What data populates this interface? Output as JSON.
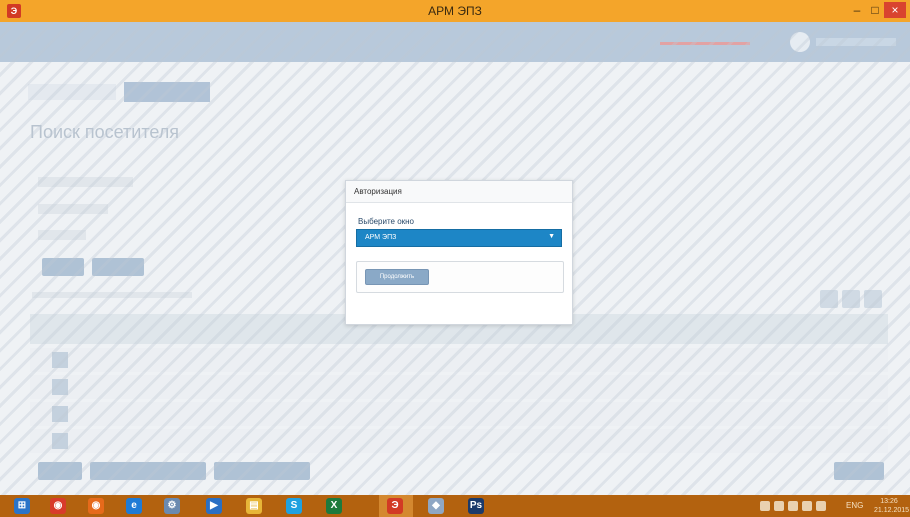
{
  "window": {
    "title": "АРМ ЭПЗ",
    "minimize_label": "–",
    "maximize_label": "□",
    "close_label": "×",
    "app_icon": "app-icon"
  },
  "background": {
    "page_title": "Поиск посетителя"
  },
  "modal": {
    "title": "Авторизация",
    "select_label": "Выберите окно",
    "select_value": "АРМ ЭПЗ",
    "continue_label": "Продолжить"
  },
  "taskbar": {
    "items": [
      {
        "name": "windows-start-icon",
        "glyph": "⊞",
        "color": "#2a74c8"
      },
      {
        "name": "chrome-icon",
        "glyph": "◉",
        "color": "#d83b2b"
      },
      {
        "name": "firefox-icon",
        "glyph": "◉",
        "color": "#e66a1b"
      },
      {
        "name": "ie-icon",
        "glyph": "e",
        "color": "#1e7bd6"
      },
      {
        "name": "network-icon",
        "glyph": "⚙",
        "color": "#6b8ab0"
      },
      {
        "name": "teamviewer-icon",
        "glyph": "▶",
        "color": "#2a6fc4"
      },
      {
        "name": "folder-icon",
        "glyph": "▤",
        "color": "#e7b638"
      },
      {
        "name": "skype-icon",
        "glyph": "S",
        "color": "#1fa1e0"
      },
      {
        "name": "excel-icon",
        "glyph": "X",
        "color": "#1d7a3c"
      },
      {
        "name": "app-icon",
        "glyph": "Э",
        "color": "#d23a24"
      },
      {
        "name": "sql-icon",
        "glyph": "◆",
        "color": "#8fa7c4"
      },
      {
        "name": "photoshop-icon",
        "glyph": "Ps",
        "color": "#1b3a6a"
      }
    ],
    "tray": {
      "language": "ENG",
      "time": "13:26",
      "date": "21.12.2015"
    }
  }
}
